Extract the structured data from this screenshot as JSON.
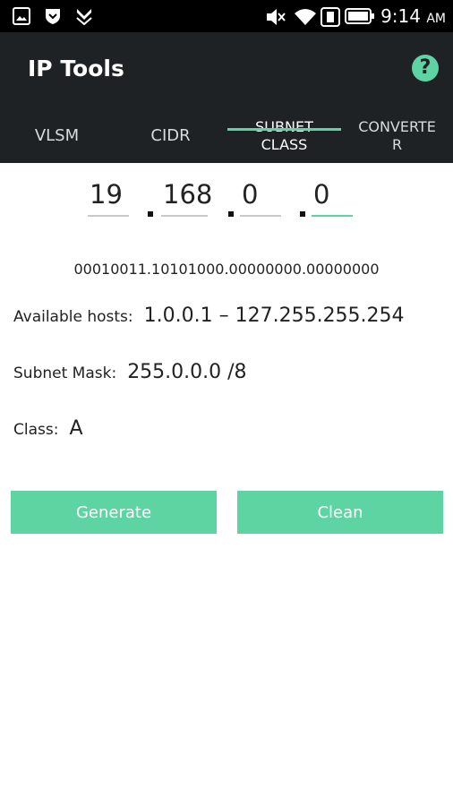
{
  "status_bar": {
    "time": "9:14",
    "ampm": "AM"
  },
  "app": {
    "title": "IP Tools"
  },
  "tabs": [
    {
      "label": "VLSM"
    },
    {
      "label": "CIDR"
    },
    {
      "label": "SUBNET\nCLASS",
      "active": true
    },
    {
      "label": "CONVERTE\nR"
    }
  ],
  "ip": {
    "octets": [
      "19",
      "168",
      "0",
      "0"
    ]
  },
  "result": {
    "binary": "00010011.10101000.00000000.00000000",
    "available_hosts_label": "Available hosts:",
    "available_hosts_value": "1.0.0.1 – 127.255.255.254",
    "subnet_mask_label": "Subnet Mask:",
    "subnet_mask_value": "255.0.0.0 /8",
    "class_label": "Class:",
    "class_value": "A"
  },
  "buttons": {
    "generate": "Generate",
    "clean": "Clean"
  },
  "colors": {
    "accent": "#5fd4a3",
    "appbar": "#1e2224"
  }
}
